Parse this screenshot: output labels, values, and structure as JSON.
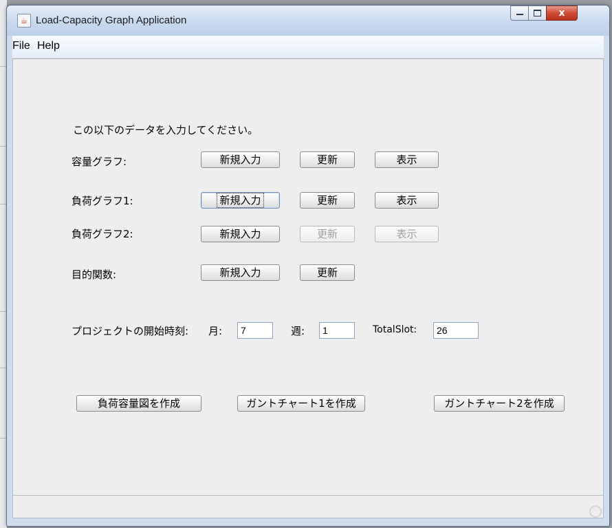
{
  "window": {
    "title": "Load-Capacity Graph Application",
    "icon": "java-cup-icon",
    "close_glyph": "x"
  },
  "menu": [
    "File",
    "Help"
  ],
  "instruction": "この以下のデータを入力してください。",
  "rows": [
    {
      "label": "容量グラフ:",
      "new": "新規入力",
      "update": "更新",
      "show": "表示",
      "update_enabled": true,
      "show_enabled": true
    },
    {
      "label": "負荷グラフ1:",
      "new": "新規入力",
      "update": "更新",
      "show": "表示",
      "update_enabled": true,
      "show_enabled": true,
      "focused": "new"
    },
    {
      "label": "負荷グラフ2:",
      "new": "新規入力",
      "update": "更新",
      "show": "表示",
      "update_enabled": false,
      "show_enabled": false
    },
    {
      "label": "目的関数:",
      "new": "新規入力",
      "update": "更新"
    }
  ],
  "start_time": {
    "label": "プロジェクトの開始時刻:",
    "month_label": "月:",
    "month_value": "7",
    "week_label": "週:",
    "week_value": "1",
    "total_label": "TotalSlot:",
    "total_value": "26"
  },
  "actions": {
    "load_capacity": "負荷容量図を作成",
    "gantt1": "ガントチャート1を作成",
    "gantt2": "ガントチャート2を作成"
  }
}
